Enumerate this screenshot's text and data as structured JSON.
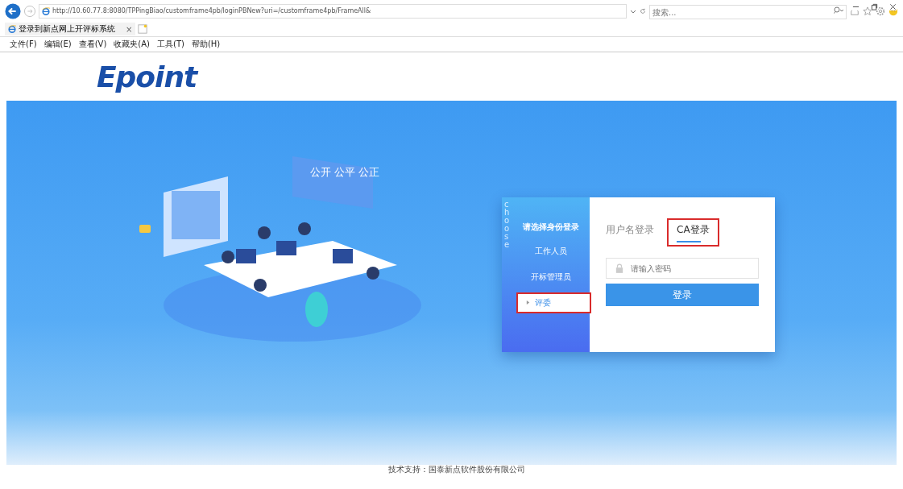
{
  "browser": {
    "url": "http://10.60.77.8:8080/TPPingBiao/customframe4pb/loginPBNew?uri=/customframe4pb/FrameAll&",
    "search": {
      "placeholder": "搜索..."
    },
    "tab": {
      "title": "登录到新点网上开评标系统",
      "close": "×"
    },
    "menu": [
      "文件(F)",
      "编辑(E)",
      "查看(V)",
      "收藏夹(A)",
      "工具(T)",
      "帮助(H)"
    ]
  },
  "logo": "Epoint",
  "illustration": {
    "sign": "公开 公平 公正"
  },
  "login": {
    "side_watermark": "choose",
    "role_title": "请选择身份登录",
    "roles": [
      {
        "label": "工作人员",
        "selected": false,
        "highlighted": false
      },
      {
        "label": "开标管理员",
        "selected": false,
        "highlighted": false
      },
      {
        "label": "评委",
        "selected": true,
        "highlighted": true
      }
    ],
    "tabs": [
      {
        "label": "用户名登录",
        "selected": false,
        "highlighted": false
      },
      {
        "label": "CA登录",
        "selected": true,
        "highlighted": true
      }
    ],
    "password": {
      "placeholder": "请输入密码"
    },
    "submit": "登录"
  },
  "footer": "技术支持：国泰新点软件股份有限公司"
}
